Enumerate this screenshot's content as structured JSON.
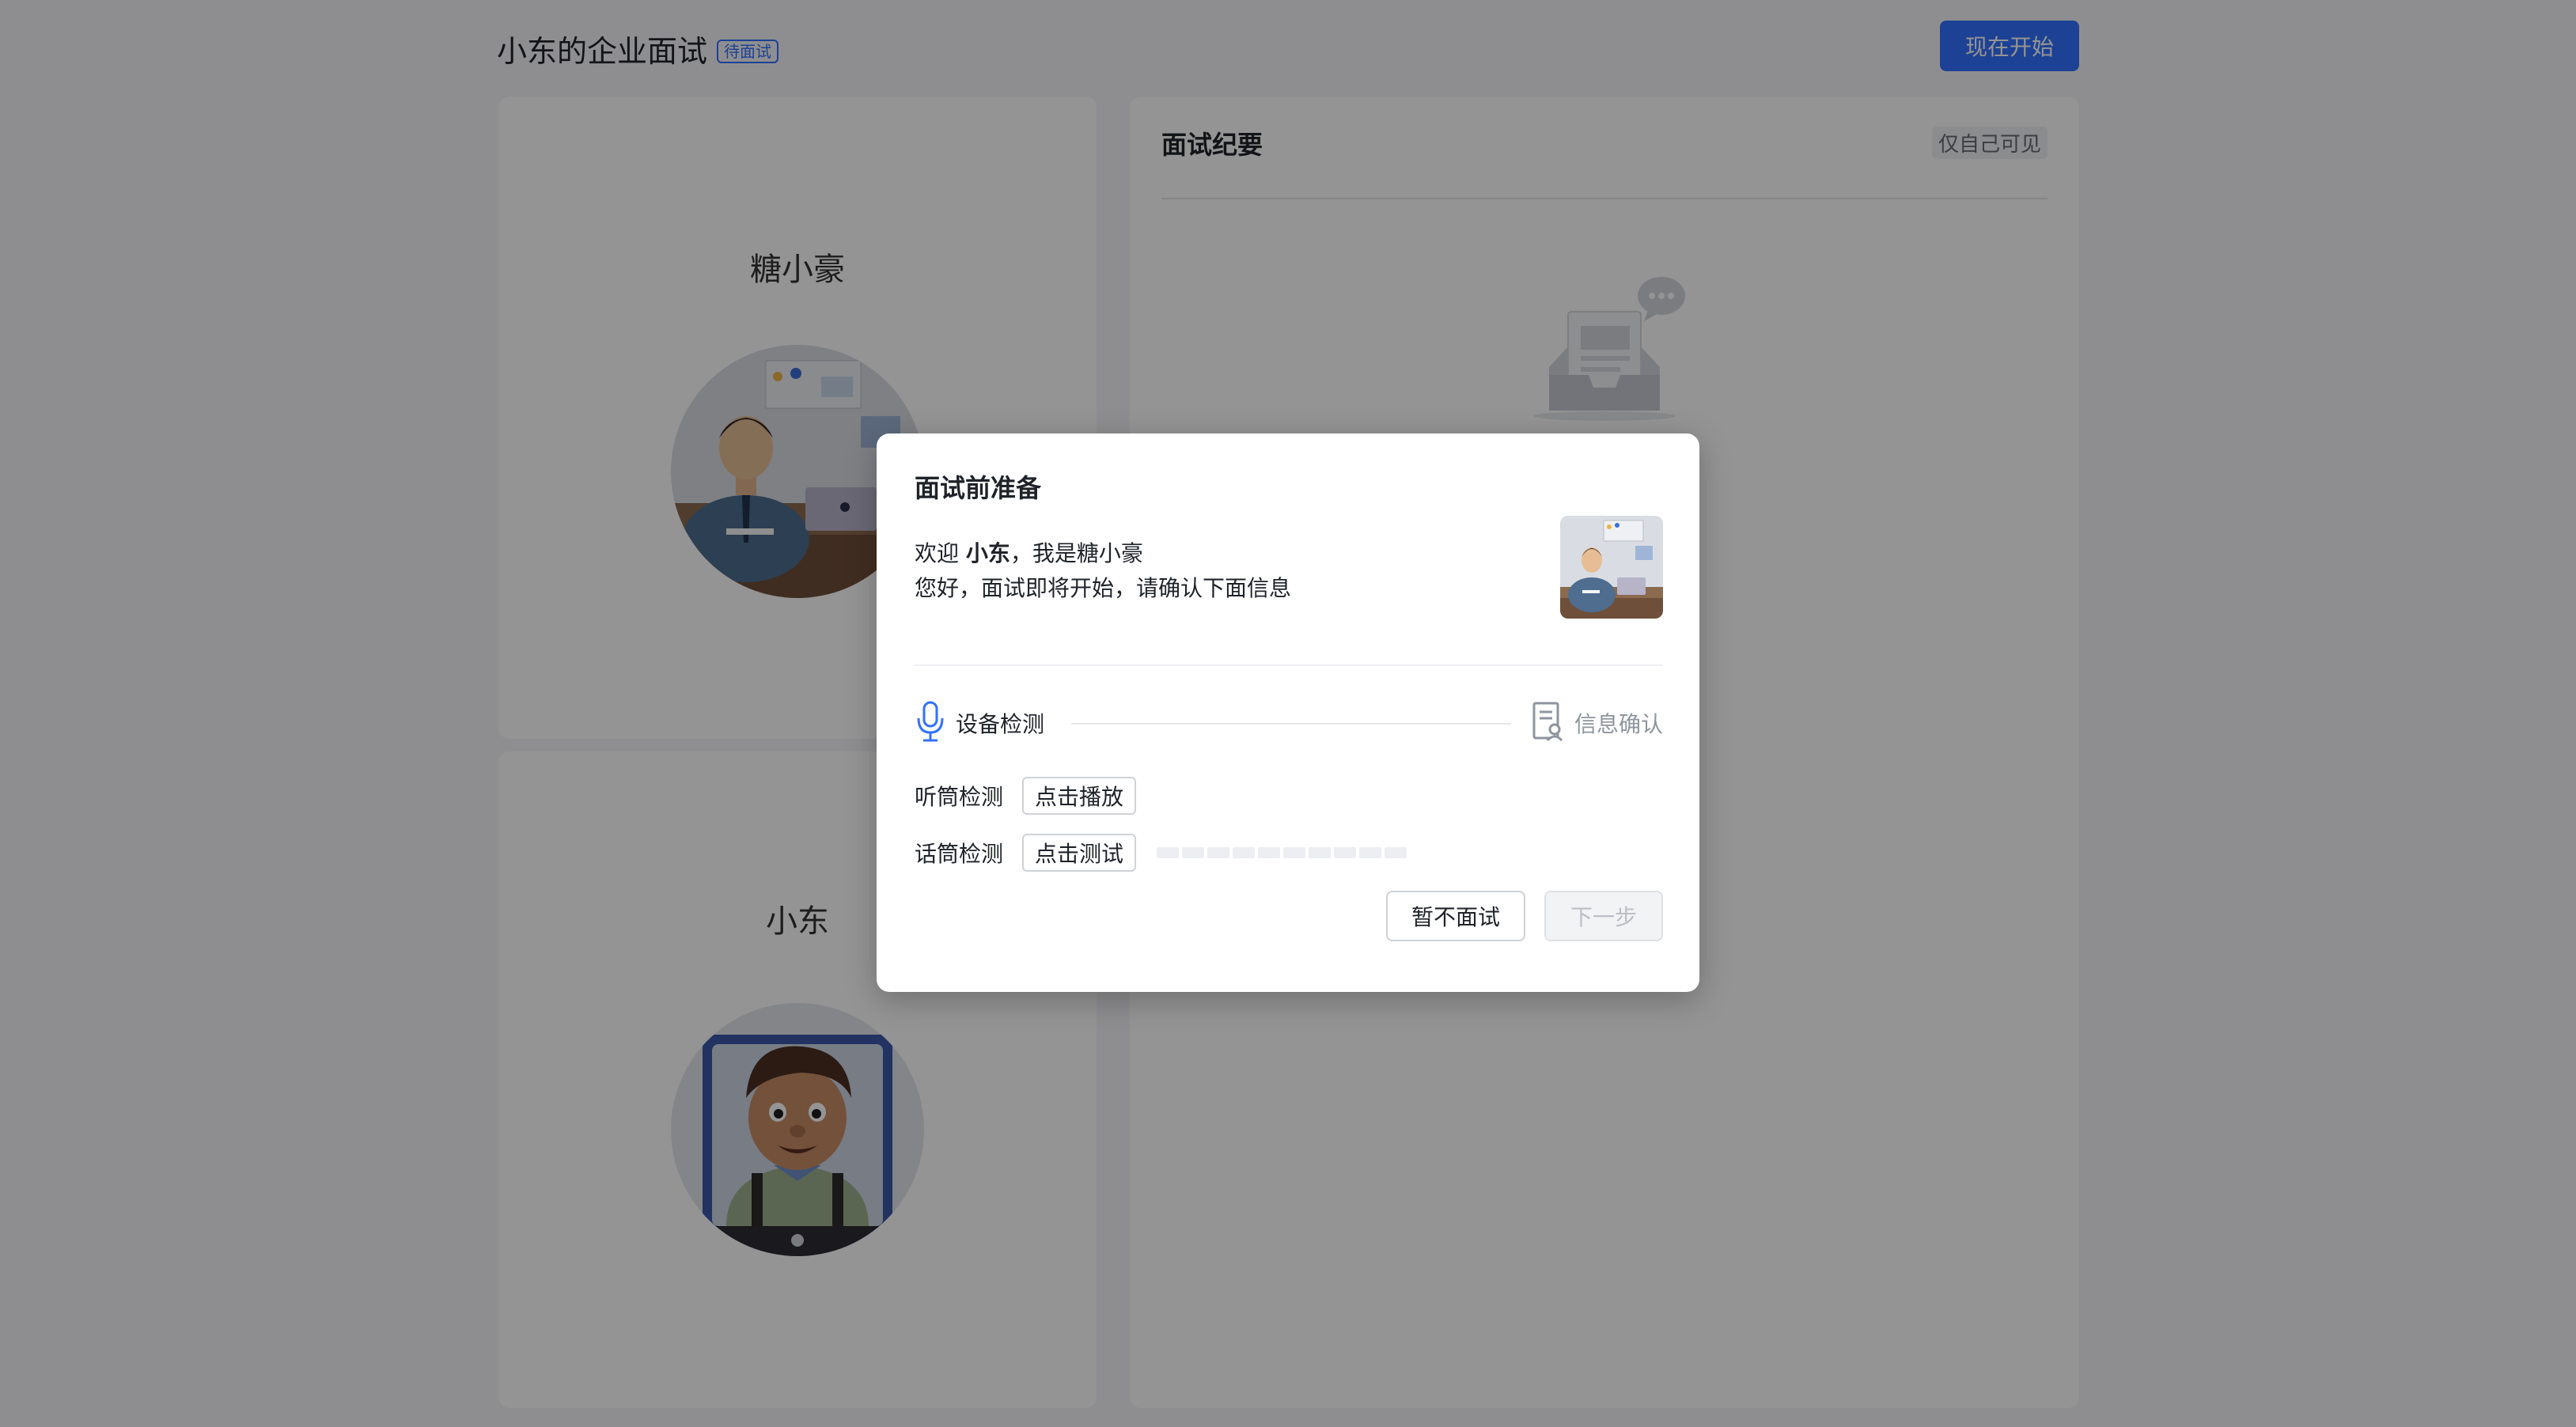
{
  "header": {
    "title": "小东的企业面试",
    "status_badge": "待面试",
    "start_button": "现在开始"
  },
  "participants": {
    "interviewer": {
      "name": "糖小豪",
      "avatar_icon": "interviewer-avatar-icon"
    },
    "candidate": {
      "name": "小东",
      "avatar_icon": "candidate-avatar-icon"
    }
  },
  "notes": {
    "title": "面试纪要",
    "visibility": "仅自己可见",
    "empty_icon": "empty-inbox-icon"
  },
  "modal": {
    "title": "面试前准备",
    "welcome_prefix": "欢迎 ",
    "welcome_name": "小东",
    "welcome_suffix": "，我是糖小豪",
    "intro": "您好，面试即将开始，请确认下面信息",
    "steps": {
      "device": {
        "label": "设备检测",
        "icon": "microphone-icon",
        "state": "active"
      },
      "info": {
        "label": "信息确认",
        "icon": "document-icon",
        "state": "pending"
      }
    },
    "checks": {
      "speaker": {
        "label": "听筒检测",
        "button": "点击播放"
      },
      "mic": {
        "label": "话筒检测",
        "button": "点击测试",
        "level": 0
      }
    },
    "not_now_button": "暂不面试",
    "next_button": "下一步"
  },
  "colors": {
    "accent": "#3370ff",
    "overlay": "rgba(0,0,0,0.42)",
    "disabled_text": "#bbbfc4"
  }
}
